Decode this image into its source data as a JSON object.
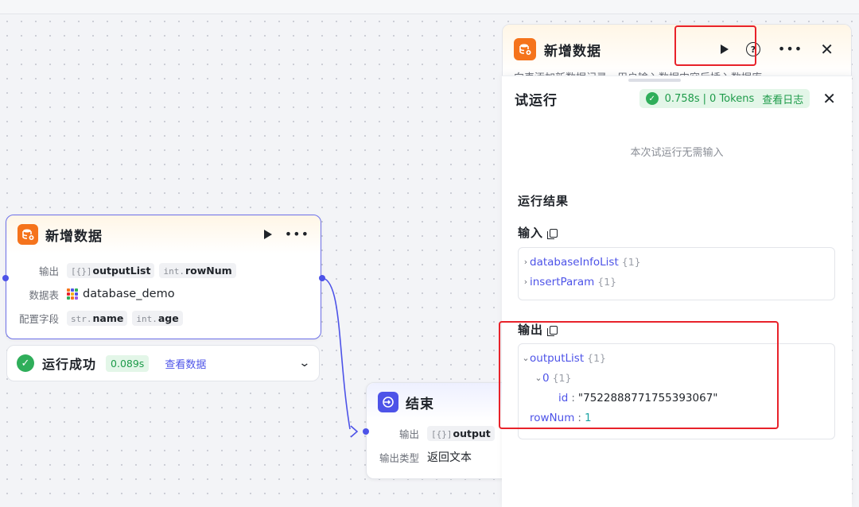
{
  "canvas": {
    "db_node": {
      "title": "新增数据",
      "output_label": "输出",
      "output_tags": [
        {
          "type": "[{}]",
          "name": "outputList"
        },
        {
          "type": "int.",
          "name": "rowNum"
        }
      ],
      "table_label": "数据表",
      "table_name": "database_demo",
      "fields_label": "配置字段",
      "field_tags": [
        {
          "type": "str.",
          "name": "name"
        },
        {
          "type": "int.",
          "name": "age"
        }
      ]
    },
    "run_status": {
      "text": "运行成功",
      "time": "0.089s",
      "view_link": "查看数据"
    },
    "end_node": {
      "title": "结束",
      "output_label": "输出",
      "output_tag": {
        "type": "[{}]",
        "name": "output"
      },
      "output_type_label": "输出类型",
      "output_type_value": "返回文本"
    }
  },
  "side_panel": {
    "title": "新增数据",
    "description": "向表添加新数据记录，用户输入数据内容后插入数据库"
  },
  "trial_run": {
    "title": "试运行",
    "time": "0.758s",
    "tokens": "0 Tokens",
    "separator": "|",
    "view_log": "查看日志",
    "no_input_text": "本次试运行无需输入",
    "result_title": "运行结果",
    "input_title": "输入",
    "input_items": [
      {
        "key": "databaseInfoList",
        "count": "{1}"
      },
      {
        "key": "insertParam",
        "count": "{1}"
      }
    ],
    "output_title": "输出",
    "output": {
      "list_key": "outputList",
      "list_count": "{1}",
      "item_index": "0",
      "item_count": "{1}",
      "id_key": "id",
      "id_value": "\"7522888771755393067\"",
      "rownum_key": "rowNum",
      "rownum_value": "1"
    }
  },
  "colors": {
    "accent": "#4d53e8",
    "db_icon": "#f5731b",
    "success": "#2fae5a",
    "highlight": "#e8222a"
  }
}
